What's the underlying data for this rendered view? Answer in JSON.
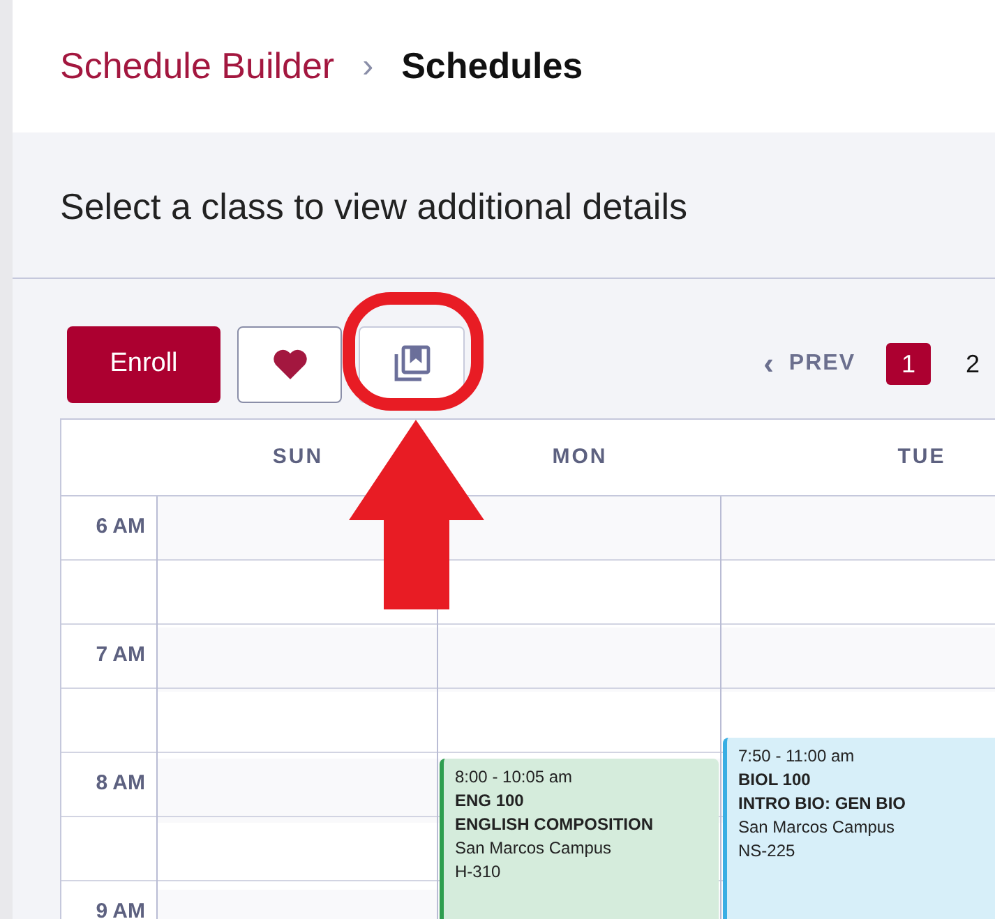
{
  "breadcrumb": {
    "parent": "Schedule Builder",
    "separator": "›",
    "current": "Schedules"
  },
  "heading": "Select a class to view additional details",
  "toolbar": {
    "enroll": "Enroll",
    "favorite": {
      "kind": "heart"
    },
    "save": {
      "kind": "bookmark",
      "highlighted": true
    }
  },
  "pagination": {
    "prev_icon": "‹",
    "prev": "PREV",
    "pages": [
      {
        "label": "1",
        "selected": true
      },
      {
        "label": "2",
        "selected": false
      }
    ]
  },
  "calendar": {
    "days": [
      {
        "label": "SUN"
      },
      {
        "label": "MON",
        "events": [
          {
            "time": "8:00 - 10:05 am",
            "code": "ENG 100",
            "title": "ENGLISH COMPOSITION",
            "campus": "San Marcos Campus",
            "room": "H-310",
            "color": "#2e9e4f"
          }
        ]
      },
      {
        "label": "TUE",
        "events": [
          {
            "time": "7:50 - 11:00 am",
            "code": "BIOL 100",
            "title": "INTRO BIO: GEN BIO",
            "campus": "San Marcos Campus",
            "room": "NS-225",
            "color": "#39aee3"
          }
        ]
      }
    ],
    "rows": [
      {
        "label": "6 AM"
      },
      {},
      {
        "label": "7 AM"
      },
      {},
      {
        "label": "8 AM"
      },
      {},
      {
        "label": "9 AM"
      }
    ]
  }
}
